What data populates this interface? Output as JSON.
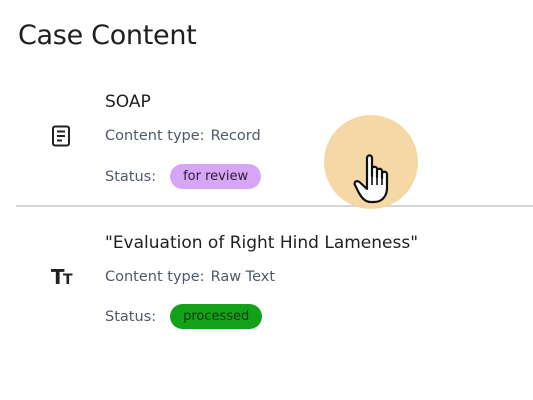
{
  "page": {
    "title": "Case Content"
  },
  "items": [
    {
      "icon": "document-icon",
      "title": "SOAP",
      "content_type_label": "Content type:",
      "content_type_value": "Record",
      "status_label": "Status:",
      "status_value": "for review",
      "status_color": "#d6a5f5"
    },
    {
      "icon": "text-format-icon",
      "icon_glyph_big": "T",
      "icon_glyph_small": "T",
      "title": "\"Evaluation of Right Hind Lameness\"",
      "content_type_label": "Content type:",
      "content_type_value": "Raw Text",
      "status_label": "Status:",
      "status_value": "processed",
      "status_color": "#14a11a"
    }
  ],
  "cursor": {
    "icon": "hand-pointer-icon",
    "highlight_color": "#f4d6a0"
  }
}
